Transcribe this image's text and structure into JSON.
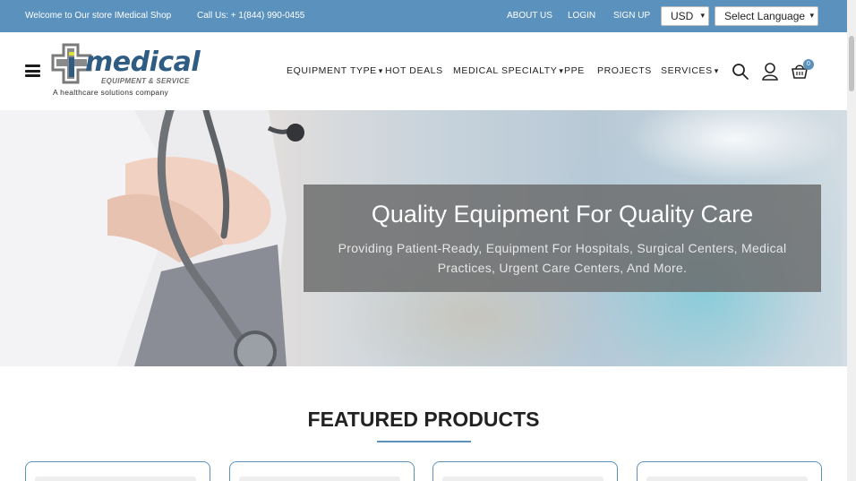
{
  "topbar": {
    "welcome": "Welcome to Our store IMedical Shop",
    "phone": "Call Us: + 1(844) 990-0455",
    "links": [
      "ABOUT US",
      "LOGIN",
      "SIGN UP"
    ],
    "currency": "USD",
    "language": "Select Language"
  },
  "header": {
    "logo": {
      "word": "medical",
      "sub": "EQUIPMENT & SERVICE",
      "tagline": "A healthcare solutions company"
    },
    "nav": [
      {
        "label": "EQUIPMENT TYPE",
        "dropdown": true
      },
      {
        "label": "HOT DEALS",
        "dropdown": false
      },
      {
        "label": "MEDICAL SPECIALTY",
        "dropdown": true
      },
      {
        "label": "PPE",
        "dropdown": false
      },
      {
        "label": "PROJECTS",
        "dropdown": false
      },
      {
        "label": "SERVICES",
        "dropdown": true
      }
    ],
    "cart_count": "0"
  },
  "hero": {
    "title": "Quality Equipment For Quality Care",
    "description": "Providing Patient-Ready, Equipment For Hospitals, Surgical Centers, Medical Practices, Urgent Care Centers, And More."
  },
  "featured": {
    "title": "FEATURED PRODUCTS"
  },
  "colors": {
    "brand": "#5a91bd",
    "logo_blue": "#2f5c83",
    "logo_accent": "#d8e33a"
  }
}
